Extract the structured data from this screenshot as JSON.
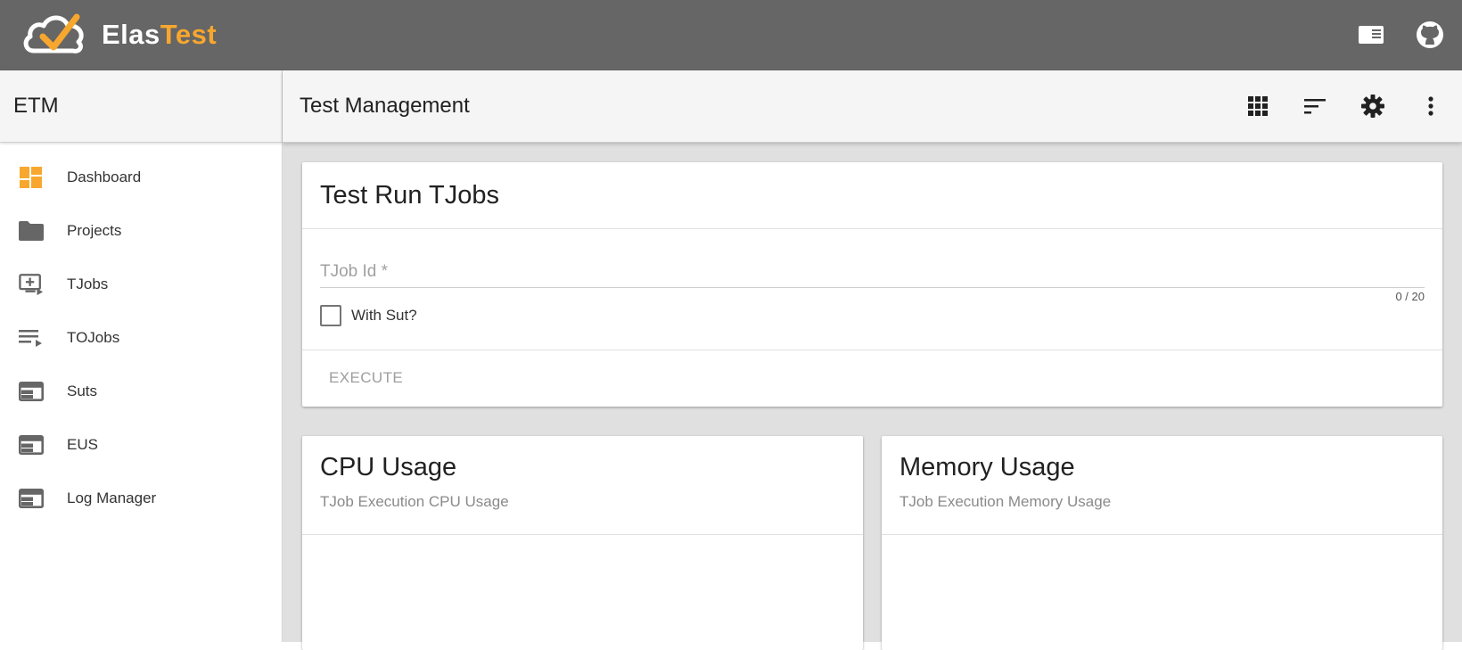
{
  "brand": {
    "part1": "Elas",
    "part2": "Test",
    "accent": "#f8a72e",
    "topbar_color": "#666666"
  },
  "topbar": {
    "icons": [
      "book-icon",
      "github-icon"
    ]
  },
  "sidebar": {
    "title": "ETM",
    "items": [
      {
        "label": "Dashboard",
        "icon": "dashboard-icon",
        "active": true
      },
      {
        "label": "Projects",
        "icon": "folder-icon"
      },
      {
        "label": "TJobs",
        "icon": "add-to-queue-icon"
      },
      {
        "label": "TOJobs",
        "icon": "playlist-play-icon"
      },
      {
        "label": "Suts",
        "icon": "web-icon"
      },
      {
        "label": "EUS",
        "icon": "web-icon"
      },
      {
        "label": "Log Manager",
        "icon": "web-icon"
      }
    ]
  },
  "main": {
    "title": "Test Management",
    "header_icons": [
      "apps-icon",
      "sort-icon",
      "settings-icon",
      "more-vert-icon"
    ],
    "run_card": {
      "title": "Test Run TJobs",
      "tjob_id": {
        "label": "TJob Id *",
        "value": "",
        "counter": "0 / 20"
      },
      "with_sut": {
        "label": "With Sut?",
        "checked": false
      },
      "execute_label": "EXECUTE"
    },
    "cpu_card": {
      "title": "CPU Usage",
      "subtitle": "TJob Execution CPU Usage"
    },
    "memory_card": {
      "title": "Memory Usage",
      "subtitle": "TJob Execution Memory Usage"
    }
  }
}
